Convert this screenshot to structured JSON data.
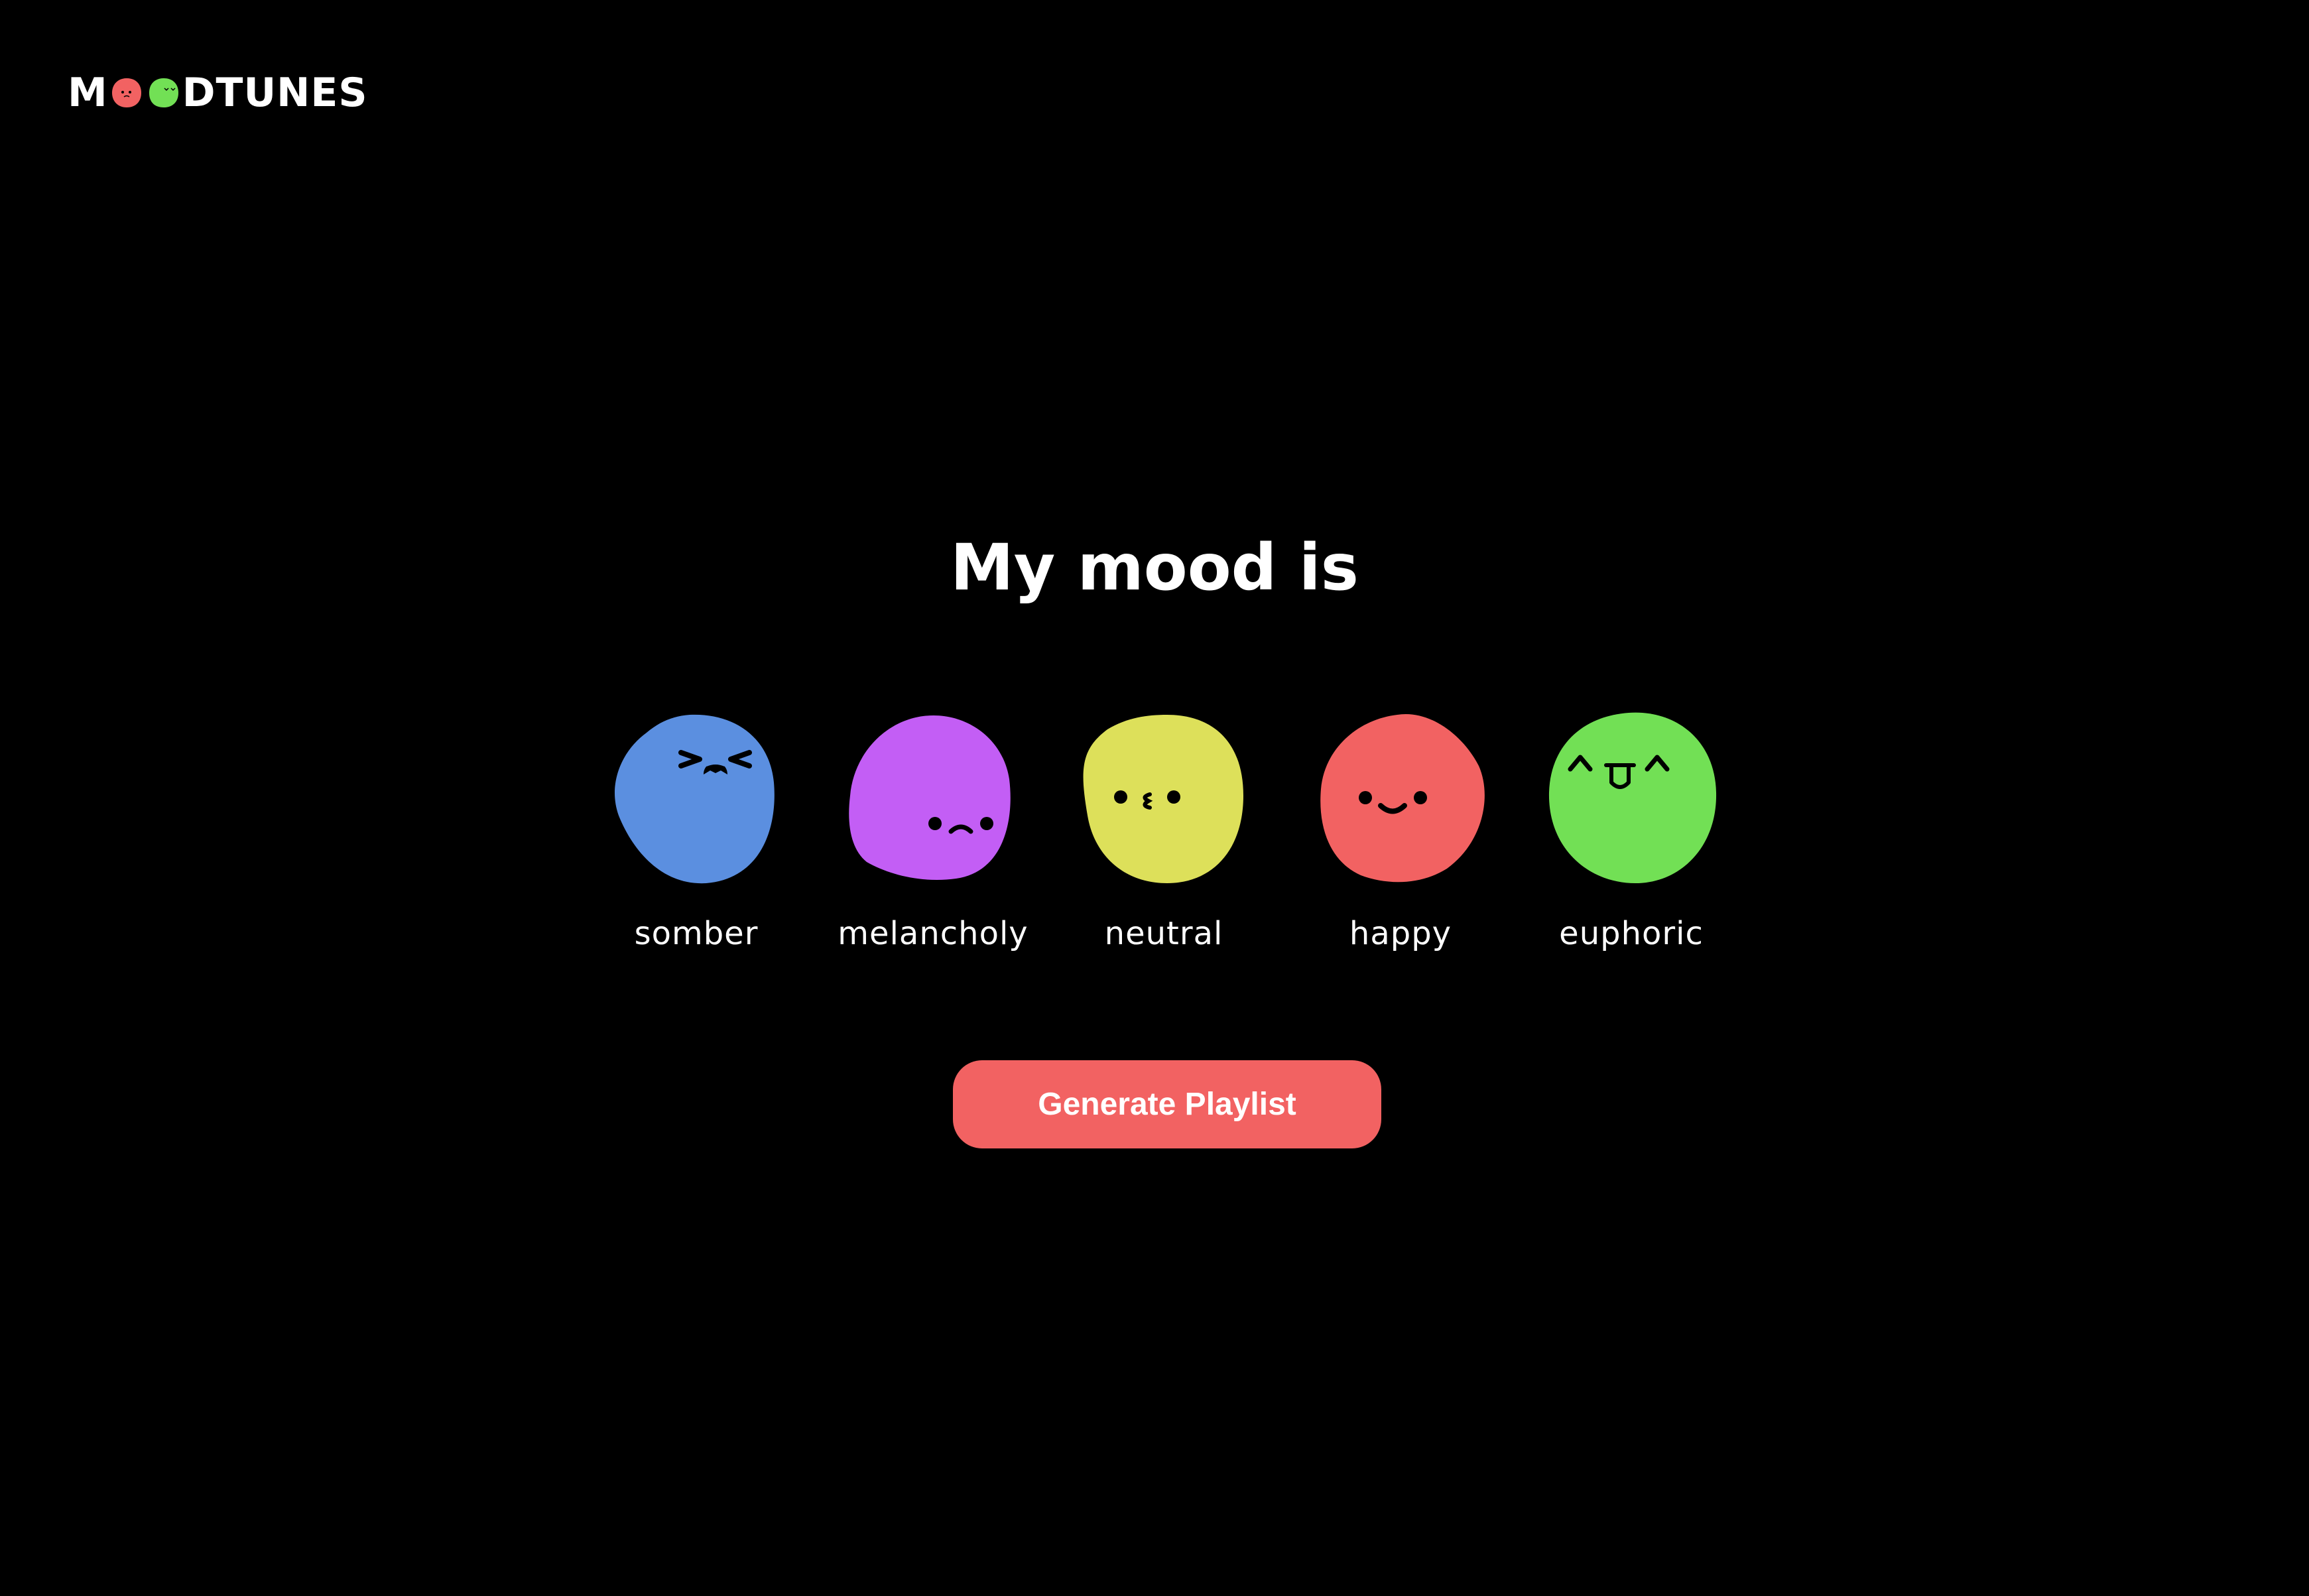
{
  "brand": {
    "prefix": "M",
    "suffix": "DTUNES"
  },
  "heading": "My mood is",
  "moods": [
    {
      "label": "somber",
      "color": "#5b8fe0",
      "icon": "crying-face-icon"
    },
    {
      "label": "melancholy",
      "color": "#c35ef5",
      "icon": "sad-face-icon"
    },
    {
      "label": "neutral",
      "color": "#dde05a",
      "icon": "kissing-face-icon"
    },
    {
      "label": "happy",
      "color": "#f26262",
      "icon": "smiling-face-icon"
    },
    {
      "label": "euphoric",
      "color": "#72e055",
      "icon": "tongue-out-face-icon"
    }
  ],
  "cta_label": "Generate Playlist",
  "colors": {
    "background": "#000000",
    "accent": "#f26262"
  }
}
